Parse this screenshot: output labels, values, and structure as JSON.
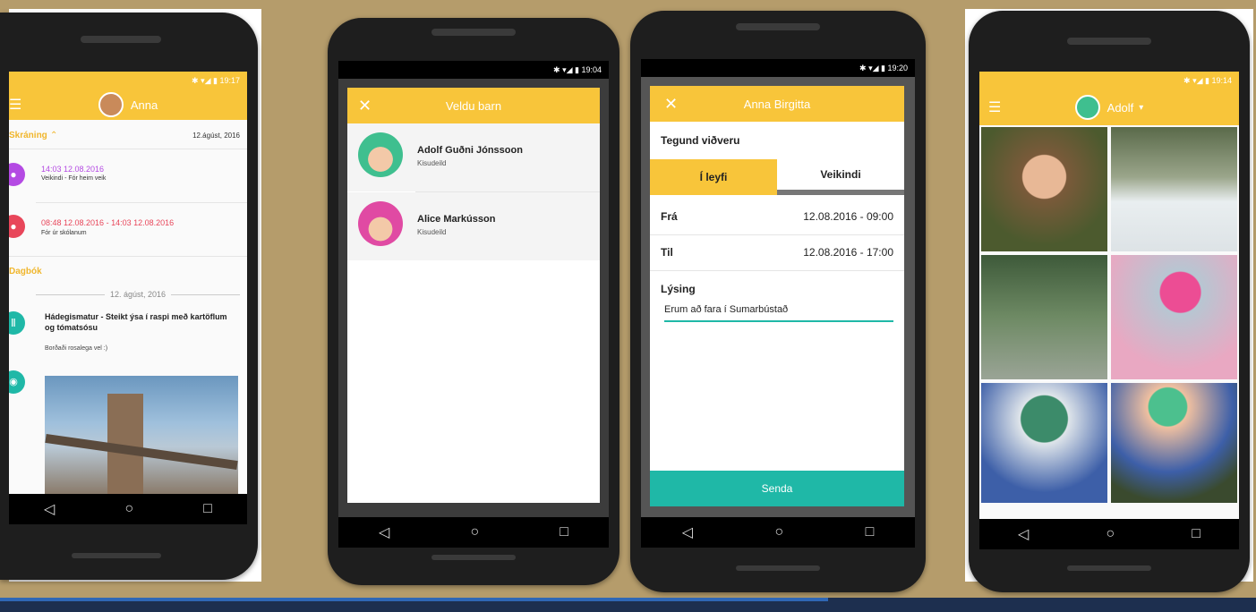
{
  "phone1": {
    "user_name": "Anna",
    "section1_title": "Skráning",
    "section1_date": "12.ágúst, 2016",
    "events": [
      {
        "time": "14:03 12.08.2016",
        "desc": "Veikindi - Fór heim veik",
        "color": "#b44ae3"
      },
      {
        "time": "08:48 12.08.2016 - 14:03 12.08.2016",
        "desc": "Fór úr skólanum",
        "color": "#e8465a"
      }
    ],
    "section2_title": "Dagbók",
    "date_divider": "12. ágúst, 2016",
    "meal_title": "Hádegismatur - Steikt ýsa í raspi með kartöflum og tómatsósu",
    "meal_note": "Borðaði rosalega vel :)",
    "colors": {
      "accent": "#f8c53a",
      "teal": "#1fb8a7"
    }
  },
  "phone2": {
    "status_time": "19:04",
    "dialog_title": "Veldu barn",
    "children": [
      {
        "name": "Adolf Guðni Jónssoon",
        "group": "Kisudeild"
      },
      {
        "name": "Alice Markússon",
        "group": "Kisudeild"
      }
    ]
  },
  "phone3": {
    "status_time": "19:20",
    "title": "Anna Birgitta",
    "type_label": "Tegund viðveru",
    "tab_leave": "Í leyfi",
    "tab_sick": "Veikindi",
    "from_label": "Frá",
    "from_value": "12.08.2016 - 09:00",
    "to_label": "Til",
    "to_value": "12.08.2016 - 17:00",
    "desc_label": "Lýsing",
    "desc_value": "Erum að fara í Sumarbústað",
    "send_label": "Senda",
    "colors": {
      "send": "#1fb8a7"
    }
  },
  "phone4": {
    "user_name": "Adolf"
  }
}
